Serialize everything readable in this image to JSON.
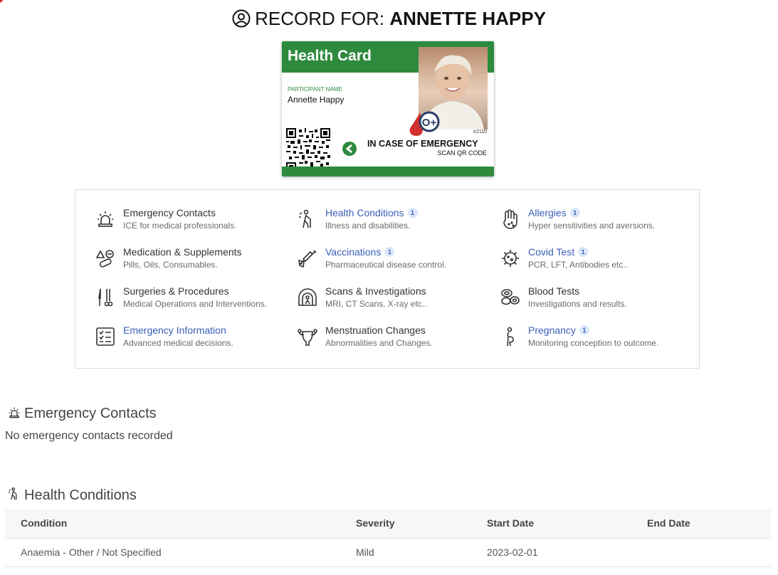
{
  "header": {
    "prefix": "RECORD FOR:",
    "name": "ANNETTE HAPPY"
  },
  "card": {
    "title": "Health Card",
    "participant_label": "PARTICIPANT NAME",
    "participant_name": "Annette Happy",
    "blood_type": "O+",
    "card_number": "e2110",
    "ice_text": "IN CASE OF EMERGENCY",
    "scan_text": "SCAN QR CODE",
    "brand_color": "#2e8b3e",
    "blood_color": "#d32f2f"
  },
  "categories": [
    {
      "title": "Emergency Contacts",
      "subtitle": "ICE for medical professionals.",
      "icon": "siren-icon",
      "linked": false
    },
    {
      "title": "Health Conditions",
      "subtitle": "Illness and disabilities.",
      "icon": "person-cane-icon",
      "linked": true,
      "badge": "1"
    },
    {
      "title": "Allergies",
      "subtitle": "Hyper sensitivities and aversions.",
      "icon": "hand-icon",
      "linked": true,
      "badge": "1"
    },
    {
      "title": "Medication & Supplements",
      "subtitle": "Pills, Oils, Consumables.",
      "icon": "pills-icon",
      "linked": false
    },
    {
      "title": "Vaccinations",
      "subtitle": "Pharmaceutical disease control.",
      "icon": "syringe-icon",
      "linked": true,
      "badge": "1"
    },
    {
      "title": "Covid Test",
      "subtitle": "PCR, LFT, Antibodies etc..",
      "icon": "virus-icon",
      "linked": true,
      "badge": "1"
    },
    {
      "title": "Surgeries & Procedures",
      "subtitle": "Medical Operations and Interventions.",
      "icon": "scalpel-icon",
      "linked": false
    },
    {
      "title": "Scans & Investigations",
      "subtitle": "MRI, CT Scans, X-ray etc..",
      "icon": "scanner-icon",
      "linked": false
    },
    {
      "title": "Blood Tests",
      "subtitle": "Investigations and results.",
      "icon": "blood-cells-icon",
      "linked": false
    },
    {
      "title": "Emergency Information",
      "subtitle": "Advanced medical decisions.",
      "icon": "checklist-icon",
      "linked": true
    },
    {
      "title": "Menstruation Changes",
      "subtitle": "Abnormalities and Changes.",
      "icon": "uterus-icon",
      "linked": false
    },
    {
      "title": "Pregnancy",
      "subtitle": "Monitoring conception to outcome.",
      "icon": "pregnant-icon",
      "linked": true,
      "badge": "1"
    }
  ],
  "emergency_contacts": {
    "heading": "Emergency Contacts",
    "empty_text": "No emergency contacts recorded"
  },
  "health_conditions": {
    "heading": "Health Conditions",
    "columns": [
      "Condition",
      "Severity",
      "Start Date",
      "End Date"
    ],
    "rows": [
      {
        "condition": "Anaemia - Other / Not Specified",
        "severity": "Mild",
        "start_date": "2023-02-01",
        "end_date": ""
      }
    ]
  }
}
